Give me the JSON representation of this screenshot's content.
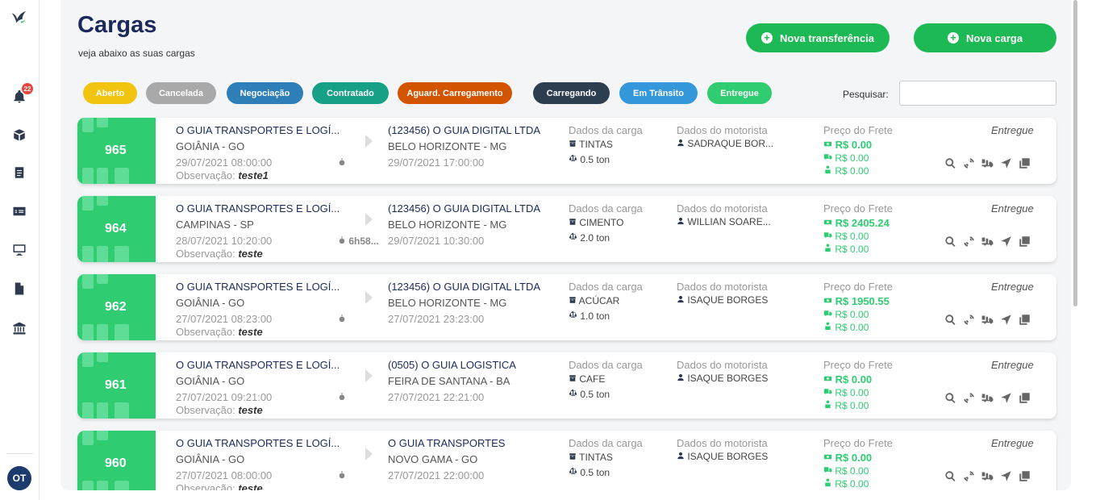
{
  "page": {
    "title": "Cargas",
    "subtitle": "veja abaixo as suas cargas"
  },
  "sidebar": {
    "notifications_count": "22",
    "avatar_initials": "OT",
    "icons": [
      "logo-bird-icon",
      "bell-icon",
      "box-icon",
      "clipboard-icon",
      "money-icon",
      "monitor-icon",
      "document-icon",
      "bank-icon"
    ]
  },
  "header": {
    "new_transfer": "Nova transferência",
    "new_cargo": "Nova carga"
  },
  "filters": [
    {
      "label": "Aberto",
      "color": "#f1c40f"
    },
    {
      "label": "Cancelada",
      "color": "#a9a9a9"
    },
    {
      "label": "Negociação",
      "color": "#2e7fb8"
    },
    {
      "label": "Contratado",
      "color": "#16a085"
    },
    {
      "label": "Aguard. Carregamento",
      "color": "#d35400"
    },
    {
      "label": "Carregando",
      "color": "#2c3e50"
    },
    {
      "label": "Em Trânsito",
      "color": "#3498db"
    },
    {
      "label": "Entregue",
      "color": "#2fcc71"
    }
  ],
  "search": {
    "label": "Pesquisar:",
    "value": ""
  },
  "labels": {
    "cargo_header": "Dados da carga",
    "driver_header": "Dados do motorista",
    "price_header": "Preço do Frete",
    "obs_label": "Observação:"
  },
  "cargas": [
    {
      "id": "965",
      "origin": "O GUIA TRANSPORTES E LOGÍ...",
      "origin_city": "GOIÂNIA - GO",
      "origin_date": "29/07/2021 08:00:00",
      "timer": "",
      "obs": "teste1",
      "dest": "(123456) O GUIA DIGITAL LTDA",
      "dest_city": "BELO HORIZONTE - MG",
      "dest_date": "29/07/2021 17:00:00",
      "cargo": "TINTAS",
      "weight": "0.5 ton",
      "driver": "SADRAQUE BOR...",
      "price1": "R$ 0.00",
      "price2": "R$ 0.00",
      "price3": "R$ 0.00",
      "status": "Entregue"
    },
    {
      "id": "964",
      "origin": "O GUIA TRANSPORTES E LOGÍ...",
      "origin_city": "CAMPINAS - SP",
      "origin_date": "28/07/2021 10:20:00",
      "timer": "6h58...",
      "obs": "teste",
      "dest": "(123456) O GUIA DIGITAL LTDA",
      "dest_city": "BELO HORIZONTE - MG",
      "dest_date": "29/07/2021 10:30:00",
      "cargo": "CIMENTO",
      "weight": "2.0 ton",
      "driver": "WILLIAN SOARE...",
      "price1": "R$ 2405.24",
      "price2": "R$ 0.00",
      "price3": "R$ 0.00",
      "status": "Entregue"
    },
    {
      "id": "962",
      "origin": "O GUIA TRANSPORTES E LOGÍ...",
      "origin_city": "GOIÂNIA - GO",
      "origin_date": "27/07/2021 08:23:00",
      "timer": "",
      "obs": "teste",
      "dest": "(123456) O GUIA DIGITAL LTDA",
      "dest_city": "BELO HORIZONTE - MG",
      "dest_date": "27/07/2021 23:23:00",
      "cargo": "ACÚCAR",
      "weight": "1.0 ton",
      "driver": "ISAQUE BORGES",
      "price1": "R$ 1950.55",
      "price2": "R$ 0.00",
      "price3": "R$ 0.00",
      "status": "Entregue"
    },
    {
      "id": "961",
      "origin": "O GUIA TRANSPORTES E LOGÍ...",
      "origin_city": "GOIÂNIA - GO",
      "origin_date": "27/07/2021 09:21:00",
      "timer": "",
      "obs": "teste",
      "dest": "(0505) O GUIA LOGISTICA",
      "dest_city": "FEIRA DE SANTANA - BA",
      "dest_date": "27/07/2021 22:21:00",
      "cargo": "CAFE",
      "weight": "0.5 ton",
      "driver": "ISAQUE BORGES",
      "price1": "R$ 0.00",
      "price2": "R$ 0.00",
      "price3": "R$ 0.00",
      "status": "Entregue"
    },
    {
      "id": "960",
      "origin": "O GUIA TRANSPORTES E LOGÍ...",
      "origin_city": "GOIÂNIA - GO",
      "origin_date": "27/07/2021 08:00:00",
      "timer": "",
      "obs": "teste",
      "dest": "O GUIA TRANSPORTES",
      "dest_city": "NOVO GAMA - GO",
      "dest_date": "27/07/2021 22:00:00",
      "cargo": "TINTAS",
      "weight": "0.5 ton",
      "driver": "ISAQUE BORGES",
      "price1": "R$ 0.00",
      "price2": "R$ 0.00",
      "price3": "R$ 0.00",
      "status": "Entregue"
    }
  ]
}
